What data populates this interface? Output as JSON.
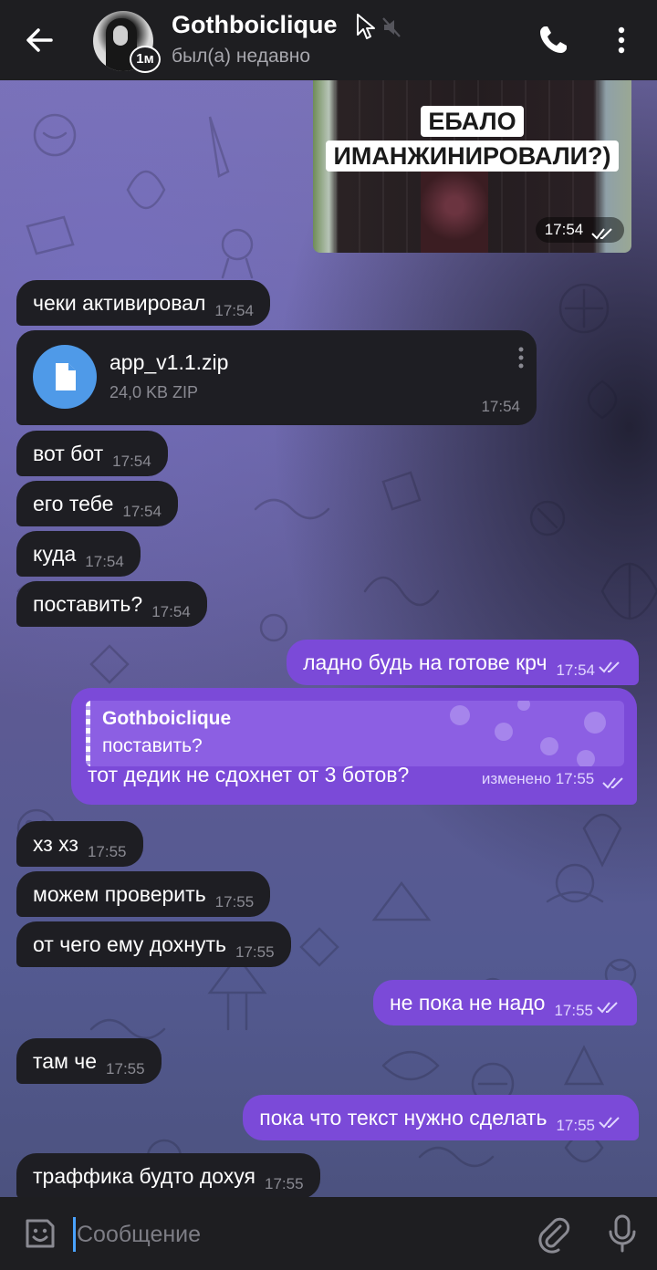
{
  "header": {
    "title": "Gothboiclique",
    "status": "был(а) недавно",
    "timer_badge": "1м",
    "icons": [
      "back-arrow-icon",
      "cursor-icon",
      "muted-icon",
      "phone-icon",
      "more-vert-icon"
    ]
  },
  "photo": {
    "caption_line1": "ЕБАЛО",
    "caption_line2": "ИМАНЖИНИРОВАЛИ?)",
    "time": "17:54"
  },
  "messages": [
    {
      "text": "чеки активировал",
      "time": "17:54"
    },
    {
      "text": "вот бот",
      "time": "17:54"
    },
    {
      "text": "его тебе",
      "time": "17:54"
    },
    {
      "text": "куда",
      "time": "17:54"
    },
    {
      "text": "поставить?",
      "time": "17:54"
    },
    {
      "text": "ладно будь на готове крч",
      "time": "17:54"
    },
    {
      "text": "хз хз",
      "time": "17:55"
    },
    {
      "text": "можем проверить",
      "time": "17:55"
    },
    {
      "text": "от чего ему дохнуть",
      "time": "17:55"
    },
    {
      "text": "не пока не надо",
      "time": "17:55"
    },
    {
      "text": "там че",
      "time": "17:55"
    },
    {
      "text": "пока что текст нужно сделать",
      "time": "17:55"
    },
    {
      "text": "траффика будто дохуя",
      "time": "17:55"
    }
  ],
  "file": {
    "name": "app_v1.1.zip",
    "size": "24,0 KB ZIP",
    "time": "17:54"
  },
  "reply": {
    "quote_author": "Gothboiclique",
    "quote_text": "поставить?",
    "text": "тот дедик не сдохнет от 3 ботов?",
    "edited_label": "изменено",
    "time": "17:55"
  },
  "input": {
    "placeholder": "Сообщение"
  },
  "colors": {
    "outgoing_bubble": "#7b4ad8",
    "incoming_bubble": "#1e1e23",
    "file_icon": "#4f9ae8",
    "header_bg": "#1e1e21"
  }
}
